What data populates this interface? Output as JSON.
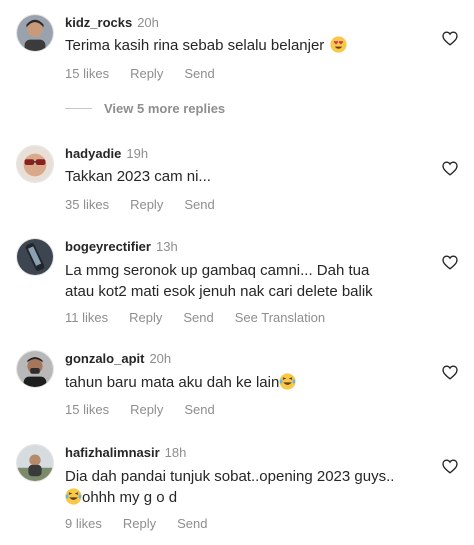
{
  "comments": [
    {
      "username": "kidz_rocks",
      "time": "20h",
      "text": "Terima kasih rina sebab selalu belanjer",
      "emoji": "heart-eyes-emoji",
      "likes": "15 likes",
      "reply": "Reply",
      "send": "Send"
    },
    {
      "username": "hadyadie",
      "time": "19h",
      "text": "Takkan 2023 cam ni...",
      "likes": "35 likes",
      "reply": "Reply",
      "send": "Send"
    },
    {
      "username": "bogeyrectifier",
      "time": "13h",
      "text_line1": "La mmg seronok up gambaq camni... Dah tua",
      "text_line2": "atau kot2 mati esok jenuh nak cari delete balik",
      "likes": "11 likes",
      "reply": "Reply",
      "send": "Send",
      "translation": "See Translation"
    },
    {
      "username": "gonzalo_apit",
      "time": "20h",
      "text": "tahun baru mata aku dah ke lain",
      "emoji": "laughing-tears-emoji",
      "likes": "15 likes",
      "reply": "Reply",
      "send": "Send"
    },
    {
      "username": "hafizhalimnasir",
      "time": "18h",
      "text_line1": "Dia dah pandai tunjuk sobat..opening 2023 guys..",
      "text_line2": "ohhh my g o d",
      "emoji": "laughing-tears-emoji",
      "likes": "9 likes",
      "reply": "Reply",
      "send": "Send"
    }
  ],
  "view_replies": "View 5 more replies",
  "colors": {
    "text": "#262626",
    "secondary": "#8e8e8e",
    "divider": "#c7c7c7",
    "emoji_face": "#f7c948"
  }
}
